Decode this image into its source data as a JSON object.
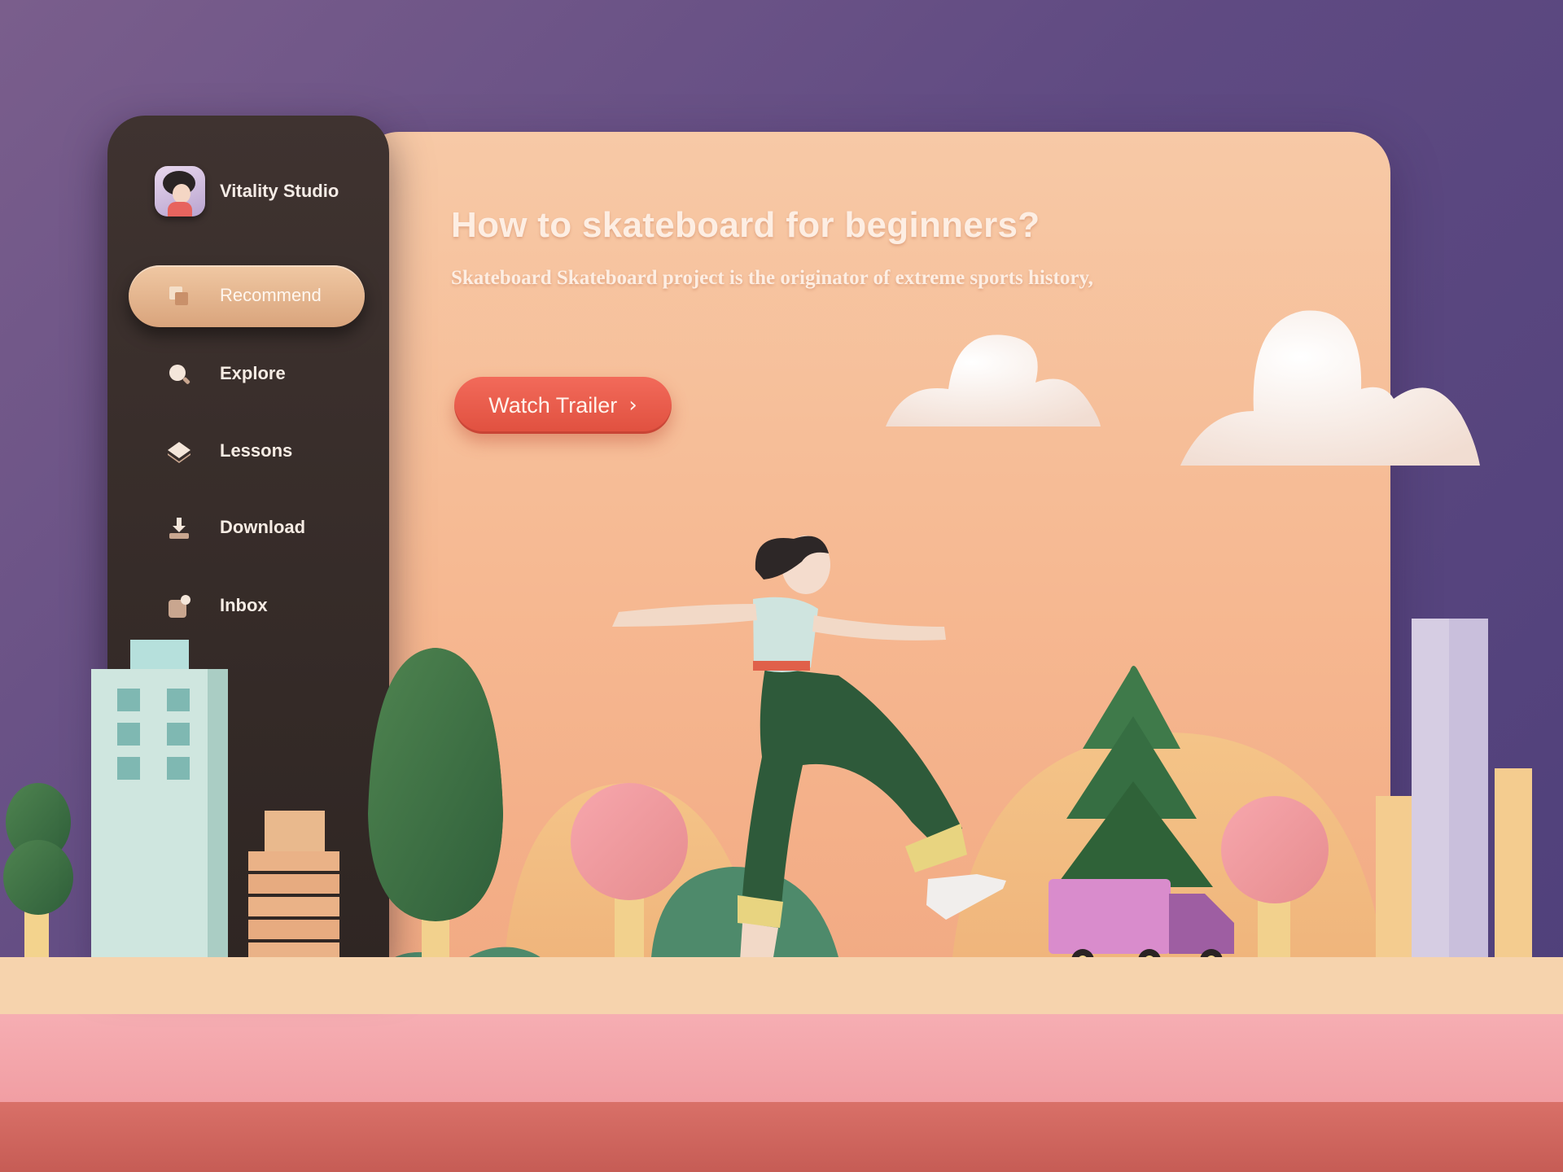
{
  "brand": {
    "name": "Vitality Studio",
    "avatar_icon": "user-avatar-icon"
  },
  "nav": {
    "items": [
      {
        "label": "Recommend",
        "icon": "stack-icon",
        "active": true
      },
      {
        "label": "Explore",
        "icon": "search-icon",
        "active": false
      },
      {
        "label": "Lessons",
        "icon": "layers-icon",
        "active": false
      },
      {
        "label": "Download",
        "icon": "download-icon",
        "active": false
      },
      {
        "label": "Inbox",
        "icon": "inbox-icon",
        "active": false
      }
    ]
  },
  "hero": {
    "title": "How to skateboard for beginners?",
    "subtitle": "Skateboard Skateboard project is the originator of extreme sports history,",
    "cta_label": "Watch Trailer",
    "cta_icon": "chevron-right-icon"
  },
  "colors": {
    "background": "#5f4a82",
    "sidebar": "#352b28",
    "card": "#f6b891",
    "accent": "#e9594a",
    "active_nav": "#e4b48c"
  }
}
